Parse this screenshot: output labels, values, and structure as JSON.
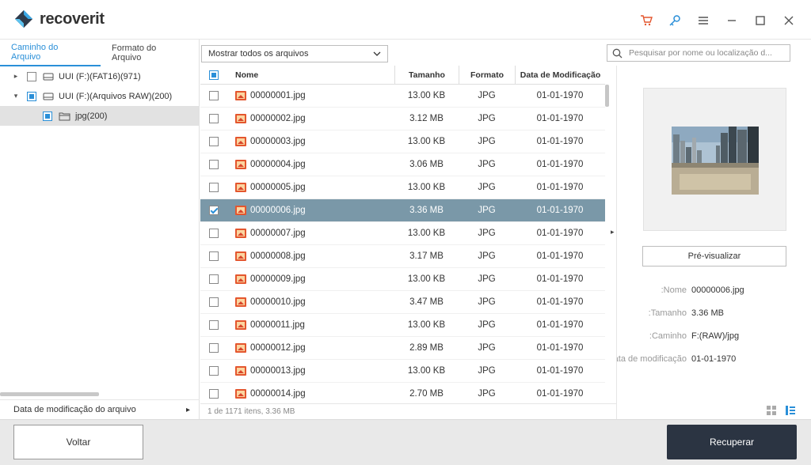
{
  "app": {
    "name": "recoverit"
  },
  "toolbar": {
    "cart_icon": "cart-icon",
    "key_icon": "key-icon",
    "menu_icon": "menu-icon",
    "accent": "#2a8fd8",
    "cart_color": "#e4562e"
  },
  "left": {
    "tabs": [
      {
        "label": "Caminho do Arquivo"
      },
      {
        "label": "Formato do Arquivo"
      }
    ],
    "tree": [
      {
        "label": "UUI (F:)(FAT16)(971)"
      },
      {
        "label": "UUI (F:)(Arquivos RAW)(200)"
      },
      {
        "label": "jpg(200)"
      }
    ],
    "footer_label": "Data de modificação do arquivo"
  },
  "filter": {
    "selected": "Mostrar todos os arquivos"
  },
  "search": {
    "placeholder": "Pesquisar por nome ou localização d..."
  },
  "list": {
    "headers": {
      "name": "Nome",
      "size": "Tamanho",
      "format": "Formato",
      "date": "Data de Modificação"
    },
    "rows": [
      {
        "name": "00000001.jpg",
        "size": "13.00  KB",
        "format": "JPG",
        "date": "01-01-1970",
        "checked": false
      },
      {
        "name": "00000002.jpg",
        "size": "3.12  MB",
        "format": "JPG",
        "date": "01-01-1970",
        "checked": false
      },
      {
        "name": "00000003.jpg",
        "size": "13.00  KB",
        "format": "JPG",
        "date": "01-01-1970",
        "checked": false
      },
      {
        "name": "00000004.jpg",
        "size": "3.06  MB",
        "format": "JPG",
        "date": "01-01-1970",
        "checked": false
      },
      {
        "name": "00000005.jpg",
        "size": "13.00  KB",
        "format": "JPG",
        "date": "01-01-1970",
        "checked": false
      },
      {
        "name": "00000006.jpg",
        "size": "3.36  MB",
        "format": "JPG",
        "date": "01-01-1970",
        "checked": true
      },
      {
        "name": "00000007.jpg",
        "size": "13.00  KB",
        "format": "JPG",
        "date": "01-01-1970",
        "checked": false
      },
      {
        "name": "00000008.jpg",
        "size": "3.17  MB",
        "format": "JPG",
        "date": "01-01-1970",
        "checked": false
      },
      {
        "name": "00000009.jpg",
        "size": "13.00  KB",
        "format": "JPG",
        "date": "01-01-1970",
        "checked": false
      },
      {
        "name": "00000010.jpg",
        "size": "3.47  MB",
        "format": "JPG",
        "date": "01-01-1970",
        "checked": false
      },
      {
        "name": "00000011.jpg",
        "size": "13.00  KB",
        "format": "JPG",
        "date": "01-01-1970",
        "checked": false
      },
      {
        "name": "00000012.jpg",
        "size": "2.89  MB",
        "format": "JPG",
        "date": "01-01-1970",
        "checked": false
      },
      {
        "name": "00000013.jpg",
        "size": "13.00  KB",
        "format": "JPG",
        "date": "01-01-1970",
        "checked": false
      },
      {
        "name": "00000014.jpg",
        "size": "2.70  MB",
        "format": "JPG",
        "date": "01-01-1970",
        "checked": false
      }
    ],
    "selected_color": "#7a98a8",
    "status": "1 de 1171 itens, 3.36  MB"
  },
  "preview": {
    "button_label": "Pré-visualizar",
    "meta": [
      {
        "key": "Nome:",
        "value": "00000006.jpg"
      },
      {
        "key": "Tamanho:",
        "value": "3.36  MB"
      },
      {
        "key": "Caminho:",
        "value": "F:(RAW)/jpg"
      },
      {
        "key": "Data de modificação:",
        "value": "01-01-1970"
      }
    ]
  },
  "footer": {
    "back_label": "Voltar",
    "recover_label": "Recuperar",
    "recover_color": "#2b3442"
  }
}
